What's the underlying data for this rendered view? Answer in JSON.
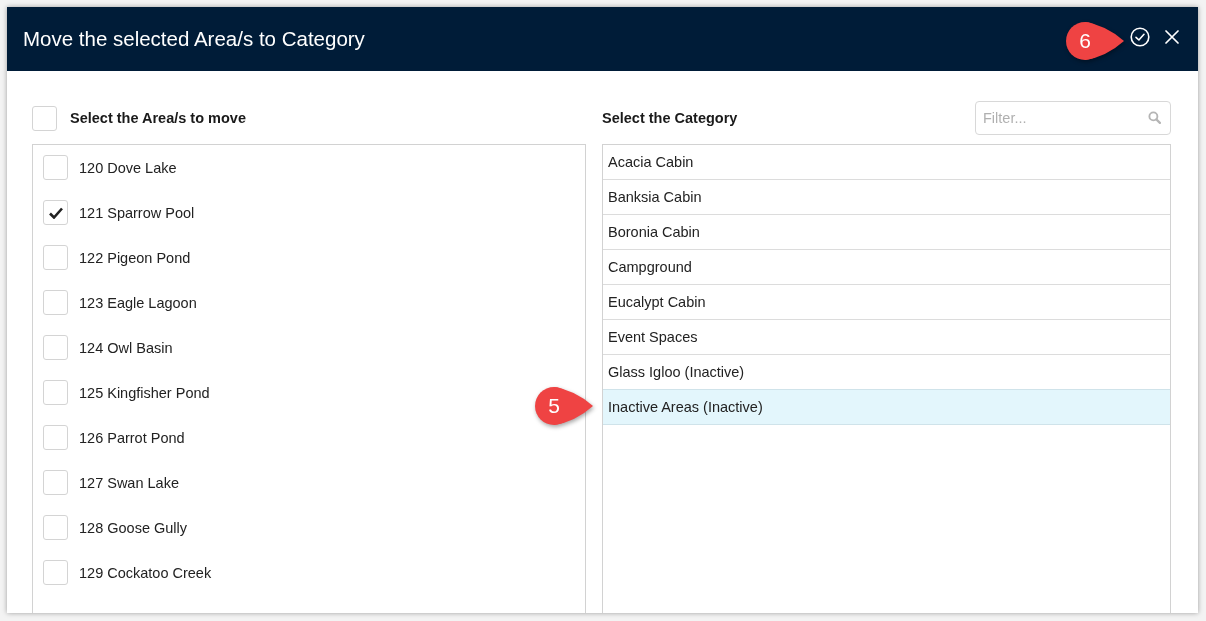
{
  "dialog": {
    "title": "Move the selected Area/s to Category",
    "actions": [
      {
        "kind": "confirm",
        "callout": "6"
      },
      {
        "kind": "close"
      }
    ]
  },
  "areas": {
    "select_all": {
      "label": "Select the Area/s to move",
      "checked": false
    },
    "items": [
      {
        "label": "120 Dove Lake",
        "checked": false
      },
      {
        "label": "121 Sparrow Pool",
        "checked": true
      },
      {
        "label": "122 Pigeon Pond",
        "checked": false
      },
      {
        "label": "123 Eagle Lagoon",
        "checked": false
      },
      {
        "label": "124 Owl Basin",
        "checked": false
      },
      {
        "label": "125 Kingfisher Pond",
        "checked": false
      },
      {
        "label": "126 Parrot Pond",
        "checked": false
      },
      {
        "label": "127 Swan Lake",
        "checked": false
      },
      {
        "label": "128 Goose Gully",
        "checked": false
      },
      {
        "label": "129 Cockatoo Creek",
        "checked": false
      }
    ]
  },
  "categories": {
    "heading": "Select the Category",
    "filter": {
      "placeholder": "Filter..."
    },
    "items": [
      {
        "label": "Acacia Cabin",
        "selected": false
      },
      {
        "label": "Banksia Cabin",
        "selected": false
      },
      {
        "label": "Boronia Cabin",
        "selected": false
      },
      {
        "label": "Campground",
        "selected": false
      },
      {
        "label": "Eucalypt Cabin",
        "selected": false
      },
      {
        "label": "Event Spaces",
        "selected": false
      },
      {
        "label": "Glass Igloo (Inactive)",
        "selected": false
      },
      {
        "label": "Inactive Areas (Inactive)",
        "selected": true,
        "callout": "5"
      }
    ]
  }
}
